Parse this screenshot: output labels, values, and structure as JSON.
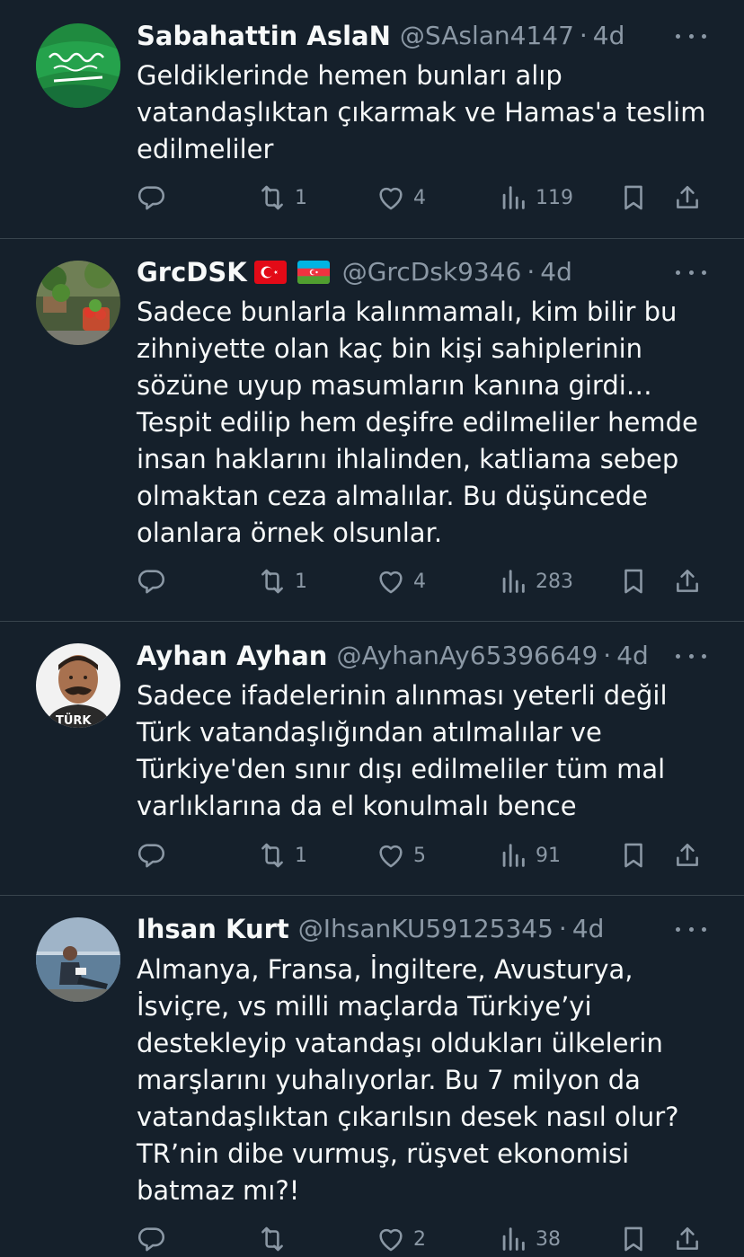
{
  "tweets": [
    {
      "name": "Sabahattin AslaN",
      "handle": "@SAslan4147",
      "time": "4d",
      "text": "Geldiklerinde hemen bunları alıp\nvatandaşlıktan çıkarmak ve Hamas'a teslim\nedilmeliler",
      "replies": "",
      "retweets": "1",
      "likes": "4",
      "views": "119"
    },
    {
      "name": "GrcDSK",
      "handle": "@GrcDsk9346",
      "time": "4d",
      "text": "Sadece bunlarla kalınmamalı, kim bilir bu\nzihniyette olan kaç bin kişi sahiplerinin\nsözüne uyup masumların kanına girdi…\nTespit edilip hem deşifre edilmeliler hemde\ninsan haklarını ihlalinden, katliama sebep\nolmaktan ceza almalılar. Bu düşüncede\nolanlara örnek olsunlar.",
      "replies": "",
      "retweets": "1",
      "likes": "4",
      "views": "283"
    },
    {
      "name": "Ayhan Ayhan",
      "handle": "@AyhanAy65396649",
      "time": "4d",
      "text": "Sadece ifadelerinin alınması yeterli değil\nTürk vatandaşlığından atılmalılar ve\nTürkiye'den sınır dışı edilmeliler tüm mal\nvarlıklarına da el konulmalı bence",
      "replies": "",
      "retweets": "1",
      "likes": "5",
      "views": "91"
    },
    {
      "name": "Ihsan Kurt",
      "handle": "@IhsanKU59125345",
      "time": "4d",
      "text": "Almanya, Fransa, İngiltere, Avusturya,\nİsviçre, vs milli maçlarda Türkiye’yi\ndestekleyip vatandaşı oldukları ülkelerin\nmarşlarını yuhalıyorlar. Bu 7 milyon da\nvatandaşlıktan çıkarılsın desek nasıl olur?\nTR’nin dibe vurmuş, rüşvet ekonomisi\nbatmaz mı?!",
      "replies": "",
      "retweets": "",
      "likes": "2",
      "views": "38"
    }
  ],
  "avatar_text": "TÜRK",
  "colors": {
    "background": "#15202b",
    "text": "#f7f9f9",
    "secondary": "#8b98a5",
    "divider": "#38444d"
  },
  "icons": [
    "reply-icon",
    "retweet-icon",
    "like-icon",
    "views-icon",
    "bookmark-icon",
    "share-icon",
    "more-icon"
  ]
}
